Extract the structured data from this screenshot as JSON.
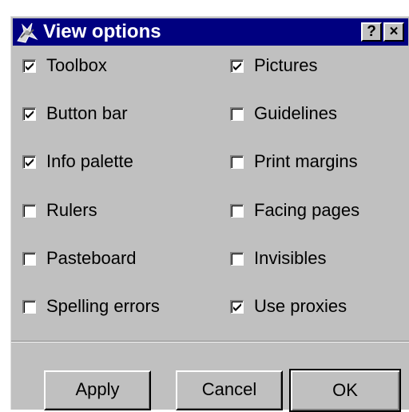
{
  "window": {
    "title": "View options",
    "help_label": "?",
    "close_label": "×"
  },
  "options": {
    "left": [
      {
        "label": "Toolbox",
        "checked": true
      },
      {
        "label": "Button bar",
        "checked": true
      },
      {
        "label": "Info palette",
        "checked": true
      },
      {
        "label": "Rulers",
        "checked": false
      },
      {
        "label": "Pasteboard",
        "checked": false
      },
      {
        "label": "Spelling errors",
        "checked": false
      }
    ],
    "right": [
      {
        "label": "Pictures",
        "checked": true
      },
      {
        "label": "Guidelines",
        "checked": false
      },
      {
        "label": "Print margins",
        "checked": false
      },
      {
        "label": "Facing pages",
        "checked": false
      },
      {
        "label": "Invisibles",
        "checked": false
      },
      {
        "label": "Use proxies",
        "checked": true
      }
    ]
  },
  "buttons": {
    "apply": "Apply",
    "cancel": "Cancel",
    "ok": "OK"
  },
  "colors": {
    "titlebar": "#000080",
    "face": "#c0c0c0"
  }
}
